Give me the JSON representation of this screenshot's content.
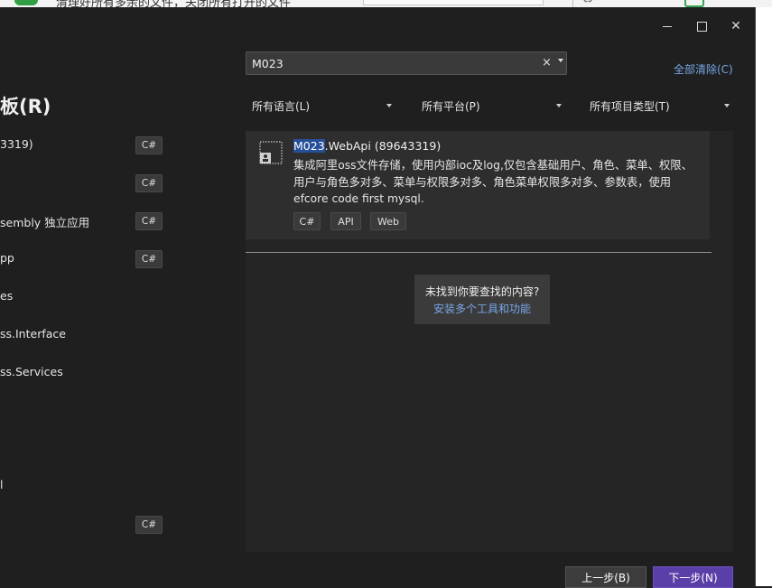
{
  "window": {
    "minimize": "–",
    "maximize": "□",
    "close": "✕"
  },
  "left_panel": {
    "heading": "板(R)",
    "items": [
      {
        "name": "3319)",
        "lang": "C#"
      },
      {
        "name": "",
        "lang": "C#"
      },
      {
        "name": "sembly 独立应用",
        "lang": "C#"
      },
      {
        "name": "pp",
        "lang": "C#"
      },
      {
        "name": "es",
        "lang": ""
      },
      {
        "name": "ss.Interface",
        "lang": ""
      },
      {
        "name": "ss.Services",
        "lang": ""
      },
      {
        "name": "l",
        "lang": ""
      },
      {
        "name": "",
        "lang": "C#"
      }
    ]
  },
  "search": {
    "value": "M023",
    "clear_label": "×"
  },
  "clear_all": "全部清除(C)",
  "filters": {
    "language": "所有语言(L)",
    "platform": "所有平台(P)",
    "project_type": "所有项目类型(T)"
  },
  "result": {
    "title_highlight": "M023",
    "title_rest": ".WebApi (89643319)",
    "description": "集成阿里oss文件存储，使用内部ioc及log,仅包含基础用户、角色、菜单、权限、用户与角色多对多、菜单与权限多对多、角色菜单权限多对多、参数表，使用efcore code first mysql.",
    "tags": [
      "C#",
      "API",
      "Web"
    ]
  },
  "not_found": {
    "question": "未找到你要查找的内容?",
    "link": "安装多个工具和功能"
  },
  "footer": {
    "back": "上一步(B)",
    "next": "下一步(N)"
  },
  "colors": {
    "background": "#1f1f1f",
    "panel": "#252526",
    "card": "#2e2e2e",
    "link": "#77a6e6",
    "highlight": "#264f9a",
    "primary_button": "#5b3fa8"
  }
}
